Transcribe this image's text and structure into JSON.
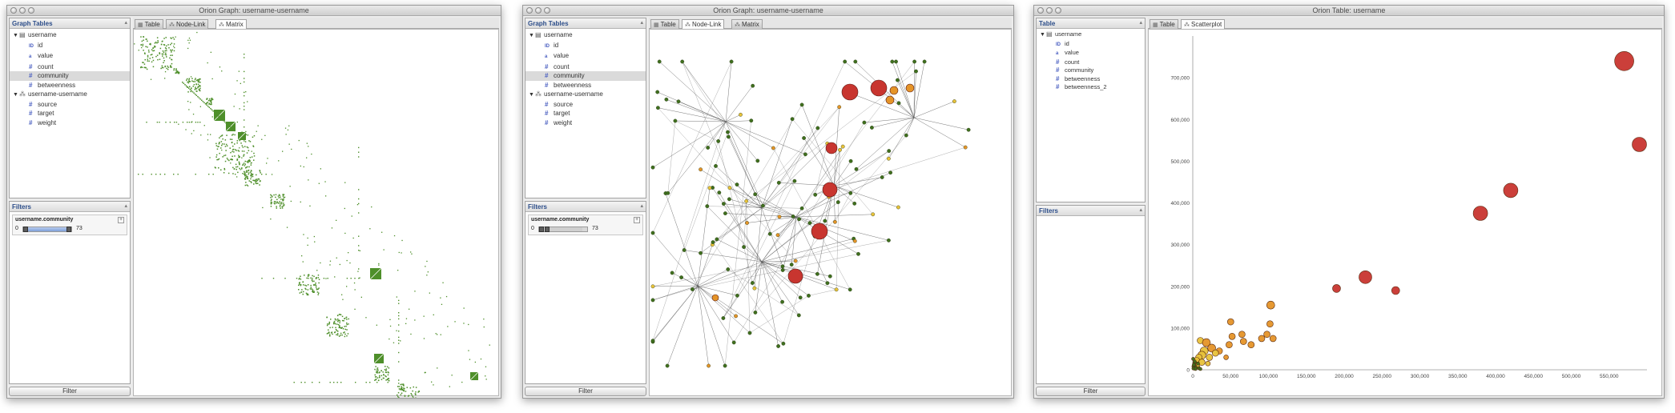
{
  "windows": [
    {
      "title": "Orion Graph: username-username",
      "sidebar_title": "Graph Tables",
      "tree": [
        {
          "label": "username",
          "icon": "table-icon",
          "level": 0,
          "expanded": true
        },
        {
          "label": "id",
          "icon": "id-icon",
          "glyph": "ID",
          "level": 1
        },
        {
          "label": "value",
          "icon": "abc-icon",
          "glyph": "abc",
          "level": 1
        },
        {
          "label": "count",
          "icon": "number-icon",
          "glyph": "#",
          "level": 1
        },
        {
          "label": "community",
          "icon": "number-icon",
          "glyph": "#",
          "level": 1,
          "selected": true
        },
        {
          "label": "betweenness",
          "icon": "number-icon",
          "glyph": "#",
          "level": 1
        },
        {
          "label": "username-username",
          "icon": "link-table-icon",
          "level": 0,
          "expanded": true
        },
        {
          "label": "source",
          "icon": "number-icon",
          "glyph": "#",
          "level": 1
        },
        {
          "label": "target",
          "icon": "number-icon",
          "glyph": "#",
          "level": 1
        },
        {
          "label": "weight",
          "icon": "number-icon",
          "glyph": "#",
          "level": 1
        }
      ],
      "filters_title": "Filters",
      "filter": {
        "label": "username.community",
        "min": "0",
        "max": "73",
        "add": "+"
      },
      "filter_button": "Filter",
      "tabs": [
        {
          "label": "Table",
          "icon": "table-tab-icon"
        },
        {
          "label": "Node-Link",
          "icon": "nodelink-tab-icon"
        },
        {
          "label": "Matrix",
          "icon": "matrix-tab-icon",
          "active": true
        }
      ]
    },
    {
      "title": "Orion Graph: username-username",
      "sidebar_title": "Graph Tables",
      "tree": [
        {
          "label": "username",
          "icon": "table-icon",
          "level": 0,
          "expanded": true
        },
        {
          "label": "id",
          "icon": "id-icon",
          "glyph": "ID",
          "level": 1
        },
        {
          "label": "value",
          "icon": "abc-icon",
          "glyph": "abc",
          "level": 1
        },
        {
          "label": "count",
          "icon": "number-icon",
          "glyph": "#",
          "level": 1
        },
        {
          "label": "community",
          "icon": "number-icon",
          "glyph": "#",
          "level": 1,
          "selected": true
        },
        {
          "label": "betweenness",
          "icon": "number-icon",
          "glyph": "#",
          "level": 1
        },
        {
          "label": "username-username",
          "icon": "link-table-icon",
          "level": 0,
          "expanded": true
        },
        {
          "label": "source",
          "icon": "number-icon",
          "glyph": "#",
          "level": 1
        },
        {
          "label": "target",
          "icon": "number-icon",
          "glyph": "#",
          "level": 1
        },
        {
          "label": "weight",
          "icon": "number-icon",
          "glyph": "#",
          "level": 1
        }
      ],
      "filters_title": "Filters",
      "filter": {
        "label": "username.community",
        "min": "0",
        "max": "73",
        "add": "+"
      },
      "filter_button": "Filter",
      "tabs": [
        {
          "label": "Table",
          "icon": "table-tab-icon"
        },
        {
          "label": "Node-Link",
          "icon": "nodelink-tab-icon",
          "active": true
        },
        {
          "label": "Matrix",
          "icon": "matrix-tab-icon"
        }
      ]
    },
    {
      "title": "Orion Table: username",
      "sidebar_title": "Table",
      "tree": [
        {
          "label": "username",
          "icon": "table-icon",
          "level": 0,
          "expanded": true
        },
        {
          "label": "id",
          "icon": "id-icon",
          "glyph": "ID",
          "level": 1
        },
        {
          "label": "value",
          "icon": "abc-icon",
          "glyph": "abc",
          "level": 1
        },
        {
          "label": "count",
          "icon": "number-icon",
          "glyph": "#",
          "level": 1
        },
        {
          "label": "community",
          "icon": "number-icon",
          "glyph": "#",
          "level": 1
        },
        {
          "label": "betweenness",
          "icon": "number-icon",
          "glyph": "#",
          "level": 1
        },
        {
          "label": "betweenness_2",
          "icon": "number-icon",
          "glyph": "#",
          "level": 1
        }
      ],
      "filters_title": "Filters",
      "filter_button": "Filter",
      "tabs": [
        {
          "label": "Table",
          "icon": "table-tab-icon"
        },
        {
          "label": "Scatterplot",
          "icon": "scatter-tab-icon",
          "active": true
        }
      ]
    }
  ],
  "colors": {
    "matrix_green": "#4e8f2a",
    "node_green": "#3f6f1e",
    "node_orange": "#e59428",
    "node_yellow": "#e8c23a",
    "node_red": "#c8352f",
    "edge": "#555555",
    "selection": "#dadada",
    "header_text": "#2d4e8a"
  },
  "chart_data": {
    "type": "scatter",
    "title": "",
    "xlabel": "",
    "ylabel": "",
    "xlim": [
      0,
      600000
    ],
    "ylim": [
      0,
      800000
    ],
    "x_ticks": [
      "0",
      "50,000",
      "100,000",
      "150,000",
      "200,000",
      "250,000",
      "300,000",
      "350,000",
      "400,000",
      "450,000",
      "500,000",
      "550,000"
    ],
    "y_ticks": [
      "0",
      "100,000",
      "200,000",
      "300,000",
      "400,000",
      "500,000",
      "600,000",
      "700,000"
    ],
    "grid": false,
    "points": [
      {
        "x": 570000,
        "y": 740000,
        "r": 12,
        "c": "red"
      },
      {
        "x": 590000,
        "y": 540000,
        "r": 9,
        "c": "red"
      },
      {
        "x": 420000,
        "y": 430000,
        "r": 9,
        "c": "red"
      },
      {
        "x": 380000,
        "y": 375000,
        "r": 9,
        "c": "red"
      },
      {
        "x": 228000,
        "y": 222000,
        "r": 8,
        "c": "red"
      },
      {
        "x": 190000,
        "y": 195000,
        "r": 5,
        "c": "red"
      },
      {
        "x": 268000,
        "y": 190000,
        "r": 5,
        "c": "red"
      },
      {
        "x": 103000,
        "y": 155000,
        "r": 5,
        "c": "orange"
      },
      {
        "x": 50000,
        "y": 115000,
        "r": 4,
        "c": "orange"
      },
      {
        "x": 102000,
        "y": 110000,
        "r": 4,
        "c": "orange"
      },
      {
        "x": 98000,
        "y": 85000,
        "r": 4,
        "c": "orange"
      },
      {
        "x": 91000,
        "y": 75000,
        "r": 4,
        "c": "orange"
      },
      {
        "x": 106000,
        "y": 75000,
        "r": 4,
        "c": "orange"
      },
      {
        "x": 65000,
        "y": 85000,
        "r": 4,
        "c": "orange"
      },
      {
        "x": 52000,
        "y": 80000,
        "r": 4,
        "c": "orange"
      },
      {
        "x": 67000,
        "y": 68000,
        "r": 4,
        "c": "orange"
      },
      {
        "x": 77000,
        "y": 60000,
        "r": 4,
        "c": "orange"
      },
      {
        "x": 48000,
        "y": 60000,
        "r": 4,
        "c": "orange"
      },
      {
        "x": 10000,
        "y": 70000,
        "r": 4,
        "c": "yellow"
      },
      {
        "x": 18000,
        "y": 65000,
        "r": 5,
        "c": "orange"
      },
      {
        "x": 25000,
        "y": 52000,
        "r": 5,
        "c": "orange"
      },
      {
        "x": 35000,
        "y": 45000,
        "r": 4,
        "c": "orange"
      },
      {
        "x": 30000,
        "y": 40000,
        "r": 4,
        "c": "yellow"
      },
      {
        "x": 15000,
        "y": 45000,
        "r": 5,
        "c": "yellow"
      },
      {
        "x": 12000,
        "y": 35000,
        "r": 5,
        "c": "yellow"
      },
      {
        "x": 8000,
        "y": 30000,
        "r": 4,
        "c": "yellow"
      },
      {
        "x": 22000,
        "y": 30000,
        "r": 4,
        "c": "yellow"
      },
      {
        "x": 44000,
        "y": 30000,
        "r": 3,
        "c": "orange"
      },
      {
        "x": 5000,
        "y": 22000,
        "r": 4,
        "c": "yellow"
      },
      {
        "x": 12000,
        "y": 18000,
        "r": 4,
        "c": "yellow"
      },
      {
        "x": 20000,
        "y": 15000,
        "r": 3,
        "c": "yellow"
      },
      {
        "x": 3000,
        "y": 15000,
        "r": 3,
        "c": "green"
      },
      {
        "x": 6000,
        "y": 10000,
        "r": 3,
        "c": "yellow"
      },
      {
        "x": 2000,
        "y": 8000,
        "r": 3,
        "c": "green"
      },
      {
        "x": 4000,
        "y": 5000,
        "r": 2,
        "c": "green"
      },
      {
        "x": 1000,
        "y": 3000,
        "r": 2,
        "c": "green"
      },
      {
        "x": 8000,
        "y": 4000,
        "r": 2,
        "c": "green"
      },
      {
        "x": 1500,
        "y": 12000,
        "r": 2,
        "c": "green"
      },
      {
        "x": 3500,
        "y": 2000,
        "r": 2,
        "c": "green"
      },
      {
        "x": 10000,
        "y": 2000,
        "r": 2,
        "c": "green"
      },
      {
        "x": 2500,
        "y": 20000,
        "r": 2,
        "c": "green"
      },
      {
        "x": 500,
        "y": 26000,
        "r": 2,
        "c": "green"
      },
      {
        "x": 7000,
        "y": 15000,
        "r": 2,
        "c": "green"
      }
    ]
  }
}
